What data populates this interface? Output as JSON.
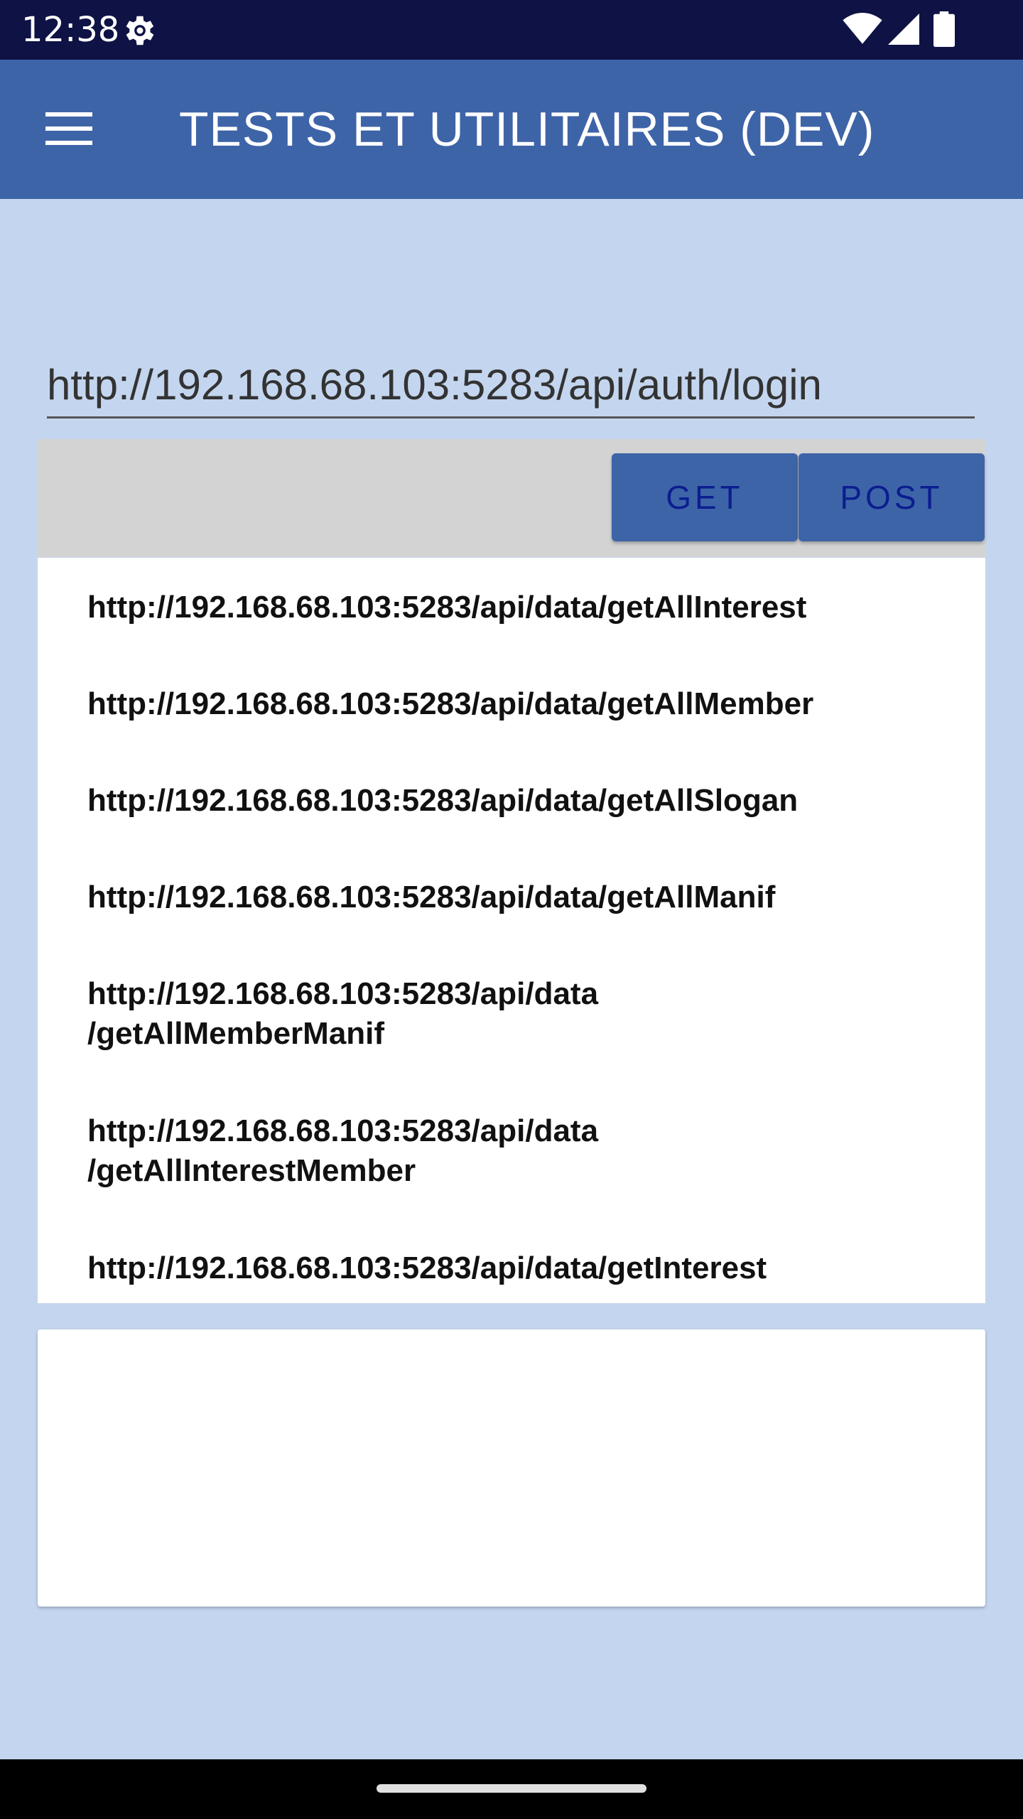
{
  "status_bar": {
    "time": "12:38",
    "icons": [
      "gear-icon",
      "wifi-icon",
      "cell-signal-icon",
      "battery-icon"
    ]
  },
  "app_bar": {
    "menu_icon": "menu-icon",
    "title": "TESTS ET UTILITAIRES (DEV)"
  },
  "url_input": {
    "value": "http://192.168.68.103:5283/api/auth/login"
  },
  "toolbar": {
    "get_label": "GET",
    "post_label": "POST"
  },
  "endpoints": [
    "http://192.168.68.103:5283/api/data/getAllInterest",
    "http://192.168.68.103:5283/api/data/getAllMember",
    "http://192.168.68.103:5283/api/data/getAllSlogan",
    "http://192.168.68.103:5283/api/data/getAllManif",
    "http://192.168.68.103:5283/api/data /getAllMemberManif",
    "http://192.168.68.103:5283/api/data /getAllInterestMember",
    "http://192.168.68.103:5283/api/data/getInterest"
  ],
  "colors": {
    "background": "#c4d6ef",
    "app_bar": "#3e64a8",
    "status_bar": "#0e1244",
    "button_text": "#0b1e8f"
  }
}
